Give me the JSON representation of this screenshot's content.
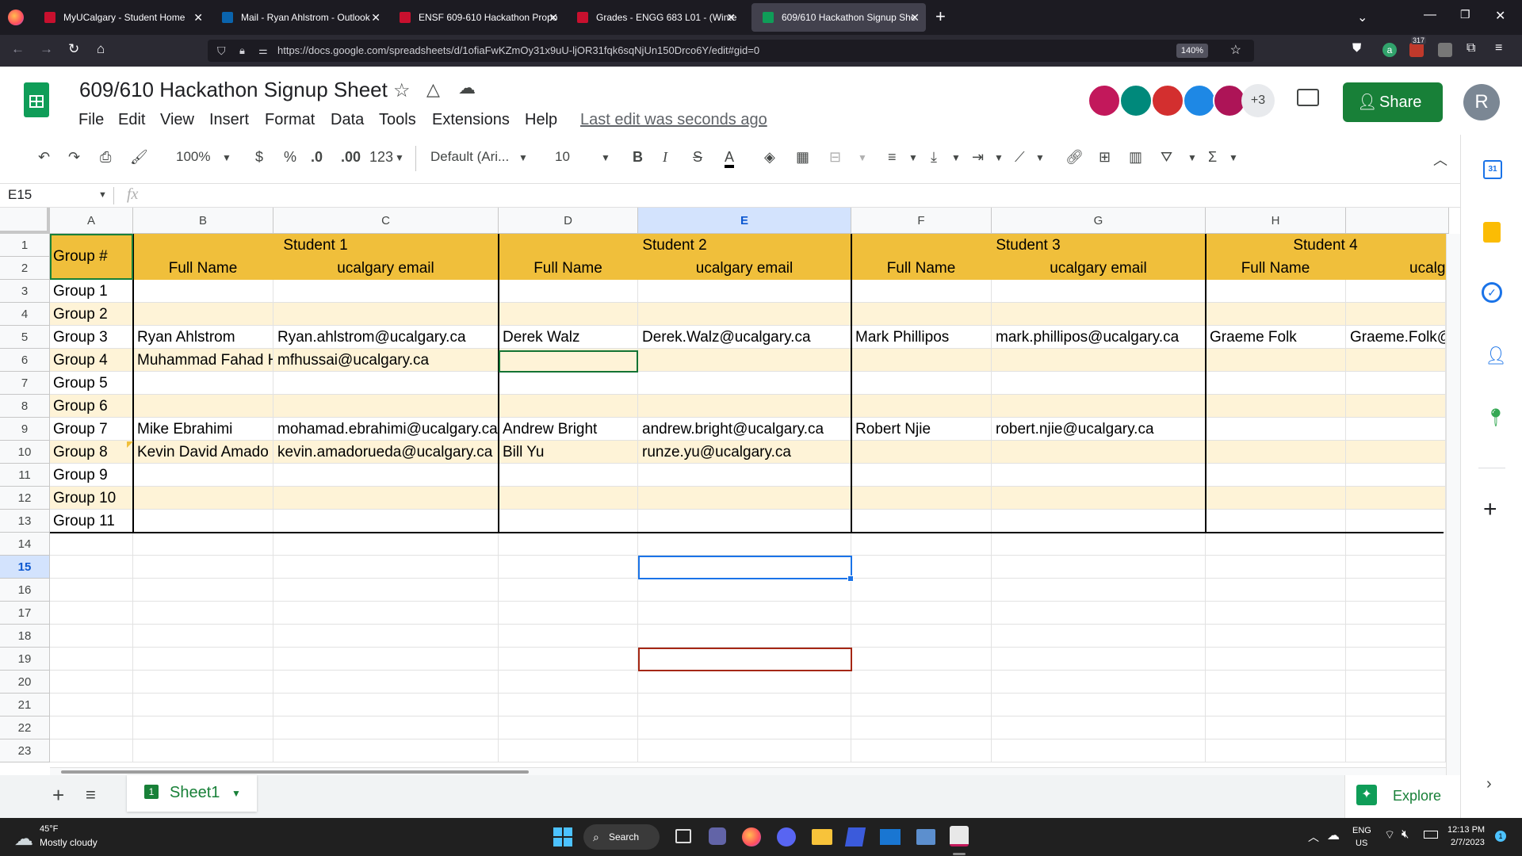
{
  "browser": {
    "tabs": [
      {
        "title": "MyUCalgary - Student Home",
        "active": false
      },
      {
        "title": "Mail - Ryan Ahlstrom - Outlook",
        "active": false
      },
      {
        "title": "ENSF 609-610 Hackathon Propo",
        "active": false
      },
      {
        "title": "Grades - ENGG 683 L01 - (Winte",
        "active": false
      },
      {
        "title": "609/610 Hackathon Signup She",
        "active": true
      }
    ],
    "url": "https://docs.google.com/spreadsheets/d/1ofiaFwKZmOy31x9uU-ljOR31fqk6sqNjUn150Drco6Y/edit#gid=0",
    "zoom": "140%",
    "badge_count": "317"
  },
  "sheets": {
    "doc_title": "609/610 Hackathon Signup Sheet",
    "menu": [
      "File",
      "Edit",
      "View",
      "Insert",
      "Format",
      "Data",
      "Tools",
      "Extensions",
      "Help"
    ],
    "last_edit": "Last edit was seconds ago",
    "extra_collaborators": "+3",
    "share_label": "Share",
    "account_initial": "R",
    "toolbar": {
      "zoom": "100%",
      "currency": "$",
      "percent": "%",
      "dec_decrease": ".0",
      "dec_increase": ".00",
      "number_format": "123",
      "font": "Default (Ari...",
      "font_size": "10"
    },
    "name_box": "E15",
    "fx": "fx"
  },
  "grid": {
    "columns": [
      "A",
      "B",
      "C",
      "D",
      "E",
      "F",
      "G",
      "H",
      ""
    ],
    "rows": [
      "1",
      "2",
      "3",
      "4",
      "5",
      "6",
      "7",
      "8",
      "9",
      "10",
      "11",
      "12",
      "13",
      "14",
      "15",
      "16",
      "17",
      "18",
      "19",
      "20",
      "21",
      "22",
      "23"
    ],
    "group_header": "Group #",
    "student_headers": [
      "Student 1",
      "Student 2",
      "Student 3",
      "Student 4"
    ],
    "subheaders": [
      "Full Name",
      "ucalgary email",
      "Full Name",
      "ucalgary email",
      "Full Name",
      "ucalgary email",
      "Full Name",
      "ucalga"
    ],
    "groups": [
      "Group 1",
      "Group 2",
      "Group 3",
      "Group 4",
      "Group 5",
      "Group 6",
      "Group 7",
      "Group 8",
      "Group 9",
      "Group 10",
      "Group 11"
    ],
    "data": [
      [
        "",
        "",
        "",
        "",
        "",
        "",
        "",
        ""
      ],
      [
        "",
        "",
        "",
        "",
        "",
        "",
        "",
        ""
      ],
      [
        "Ryan Ahlstrom",
        "Ryan.ahlstrom@ucalgary.ca",
        "Derek Walz",
        "Derek.Walz@ucalgary.ca",
        "Mark Phillipos",
        "mark.phillipos@ucalgary.ca",
        "Graeme Folk",
        "Graeme.Folk@"
      ],
      [
        "Muhammad Fahad Hu",
        "mfhussai@ucalgary.ca",
        "",
        "",
        "",
        "",
        "",
        ""
      ],
      [
        "",
        "",
        "",
        "",
        "",
        "",
        "",
        ""
      ],
      [
        "",
        "",
        "",
        "",
        "",
        "",
        "",
        ""
      ],
      [
        "Mike Ebrahimi",
        "mohamad.ebrahimi@ucalgary.ca",
        "Andrew Bright",
        "andrew.bright@ucalgary.ca",
        "Robert Njie",
        "robert.njie@ucalgary.ca",
        "",
        ""
      ],
      [
        "Kevin David Amado R",
        "kevin.amadorueda@ucalgary.ca",
        "Bill Yu",
        "runze.yu@ucalgary.ca",
        "",
        "",
        "",
        ""
      ],
      [
        "",
        "",
        "",
        "",
        "",
        "",
        "",
        ""
      ],
      [
        "",
        "",
        "",
        "",
        "",
        "",
        "",
        ""
      ],
      [
        "",
        "",
        "",
        "",
        "",
        "",
        "",
        ""
      ]
    ]
  },
  "bottom": {
    "sheet_tab": "Sheet1",
    "sheet_tab_number": "1",
    "explore": "Explore"
  },
  "taskbar": {
    "temp": "45°F",
    "weather": "Mostly cloudy",
    "search": "Search",
    "lang1": "ENG",
    "lang2": "US",
    "time": "12:13 PM",
    "date": "2/7/2023",
    "notif": "1"
  },
  "colors": {
    "header_yellow": "#f0bf3b",
    "band": "#fef3d7",
    "share_green": "#188038",
    "sheets_green": "#0f9d58"
  }
}
